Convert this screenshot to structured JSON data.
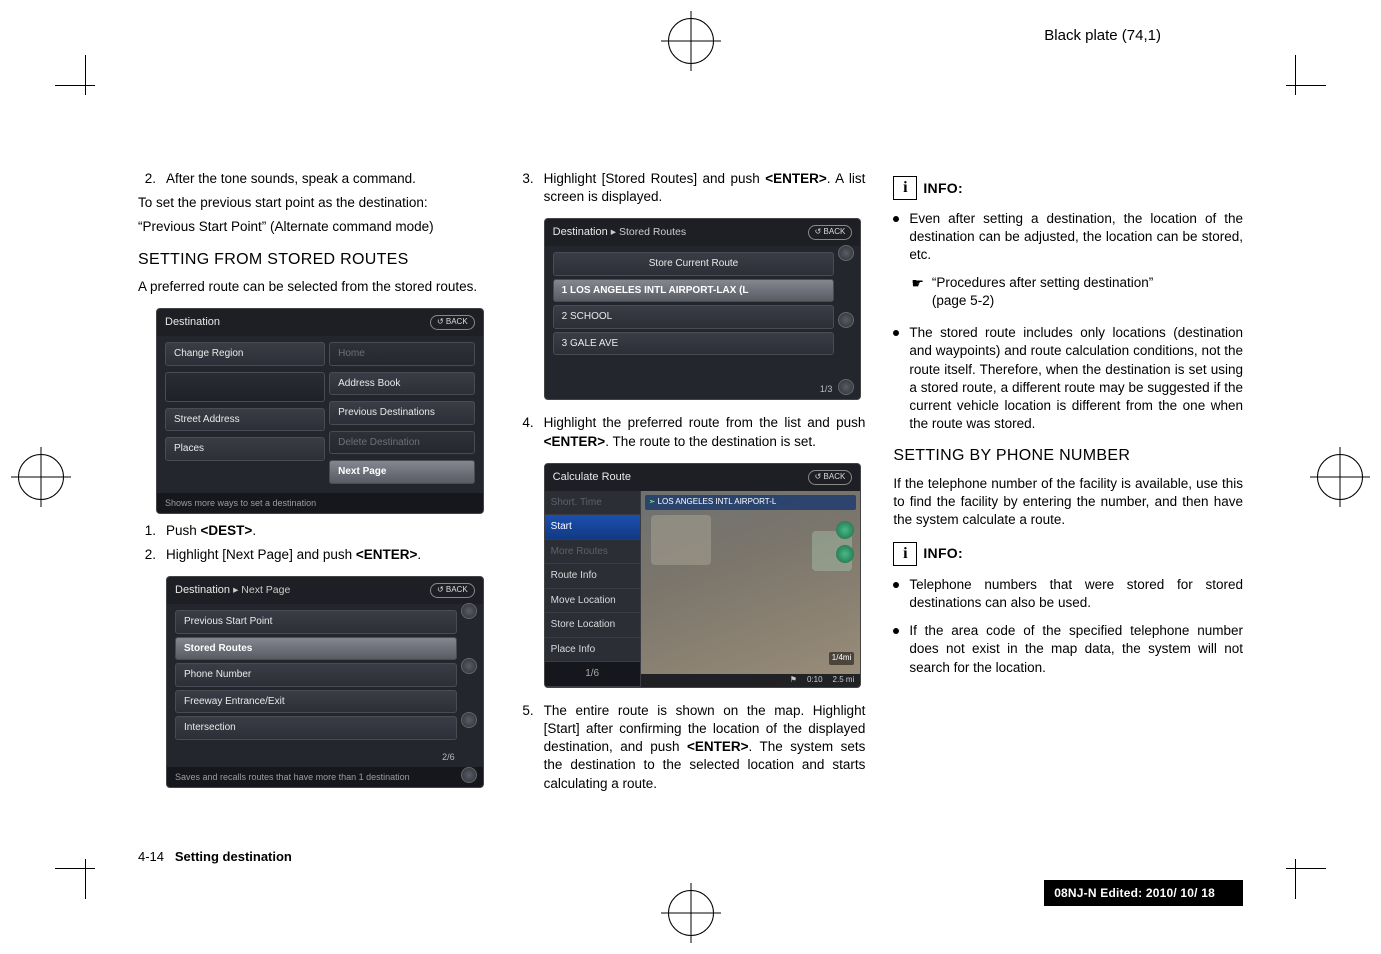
{
  "plate": "Black plate (74,1)",
  "col1": {
    "step2_num": "2.",
    "step2_text": "After the tone sounds, speak a command.",
    "prev_intro": "To set the previous start point as the destination:",
    "prev_cmd": "“Previous Start Point” (Alternate command mode)",
    "h_stored": "SETTING FROM STORED ROUTES",
    "stored_body": "A preferred route can be selected from the stored routes.",
    "ss1": {
      "title": "Destination",
      "back": "↺ BACK",
      "left": [
        "Change Region",
        "",
        "Street Address",
        "Places"
      ],
      "right": [
        "Home",
        "Address Book",
        "Previous Destinations",
        "Delete Destination",
        "Next Page"
      ],
      "hint": "Shows more ways to set a destination"
    },
    "s1_num": "1.",
    "s1_text_a": "Push ",
    "s1_text_b": "<DEST>",
    "s1_text_c": ".",
    "s2_num": "2.",
    "s2_text_a": "Highlight [Next Page] and push ",
    "s2_text_b": "<ENTER>",
    "s2_text_c": ".",
    "ss2": {
      "title_a": "Destination",
      "title_b": "▸ Next Page",
      "back": "↺ BACK",
      "rows": [
        "Previous Start Point",
        "Stored Routes",
        "Phone Number",
        "Freeway Entrance/Exit",
        "Intersection"
      ],
      "pager": "2/6",
      "hint": "Saves and recalls routes that have more than 1 destination"
    }
  },
  "col2": {
    "s3_num": "3.",
    "s3_text_a": "Highlight [Stored Routes] and push ",
    "s3_text_b": "<ENTER>",
    "s3_text_c": ". A list screen is displayed.",
    "ss3": {
      "title_a": "Destination",
      "title_b": "▸ Stored Routes",
      "back": "↺ BACK",
      "store": "Store Current Route",
      "rows": [
        "1  LOS ANGELES INTL AIRPORT-LAX (L",
        "2  SCHOOL",
        "3  GALE AVE"
      ],
      "pager": "1/3"
    },
    "s4_num": "4.",
    "s4_text_a": "Highlight the preferred route from the list and push ",
    "s4_text_b": "<ENTER>",
    "s4_text_c": ". The route to the destination is set.",
    "ss4": {
      "title": "Calculate Route",
      "back": "↺ BACK",
      "menu": [
        "Short. Time",
        "Start",
        "More Routes",
        "Route Info",
        "Move Location",
        "Store Location",
        "Place Info"
      ],
      "maplabel": "LOS ANGELES INTL AIRPORT-L",
      "foot_pager": "1/6",
      "foot_time": "0:10",
      "foot_dist": "2.5 mi",
      "scale": "1/4mi"
    },
    "s5_num": "5.",
    "s5_text_a": "The entire route is shown on the map. Highlight [Start] after confirming the location of the displayed destination, and push ",
    "s5_text_b": "<ENTER>",
    "s5_text_c": ". The system sets the destination to the selected location and starts calculating a route."
  },
  "col3": {
    "info": "INFO:",
    "b1": "Even after setting a destination, the location of the destination can be adjusted, the location can be stored, etc.",
    "xref_icon": "☛",
    "xref_a": "“Procedures after setting destination”",
    "xref_b": "(page 5-2)",
    "b2": "The stored route includes only locations (destination and waypoints) and route calculation conditions, not the route itself. Therefore, when the destination is set using a stored route, a different route may be suggested if the current vehicle location is different from the one when the route was stored.",
    "h_phone": "SETTING BY PHONE NUMBER",
    "phone_body": "If the telephone number of the facility is available, use this to find the facility by entering the number, and then have the system calculate a route.",
    "info2": "INFO:",
    "b3": "Telephone numbers that were stored for stored destinations can also be used.",
    "b4": "If the area code of the specified telephone number does not exist in the map data, the system will not search for the location."
  },
  "footer": {
    "pageno": "4-14",
    "section": "Setting destination",
    "edited": "08NJ-N Edited:  2010/ 10/ 18"
  }
}
